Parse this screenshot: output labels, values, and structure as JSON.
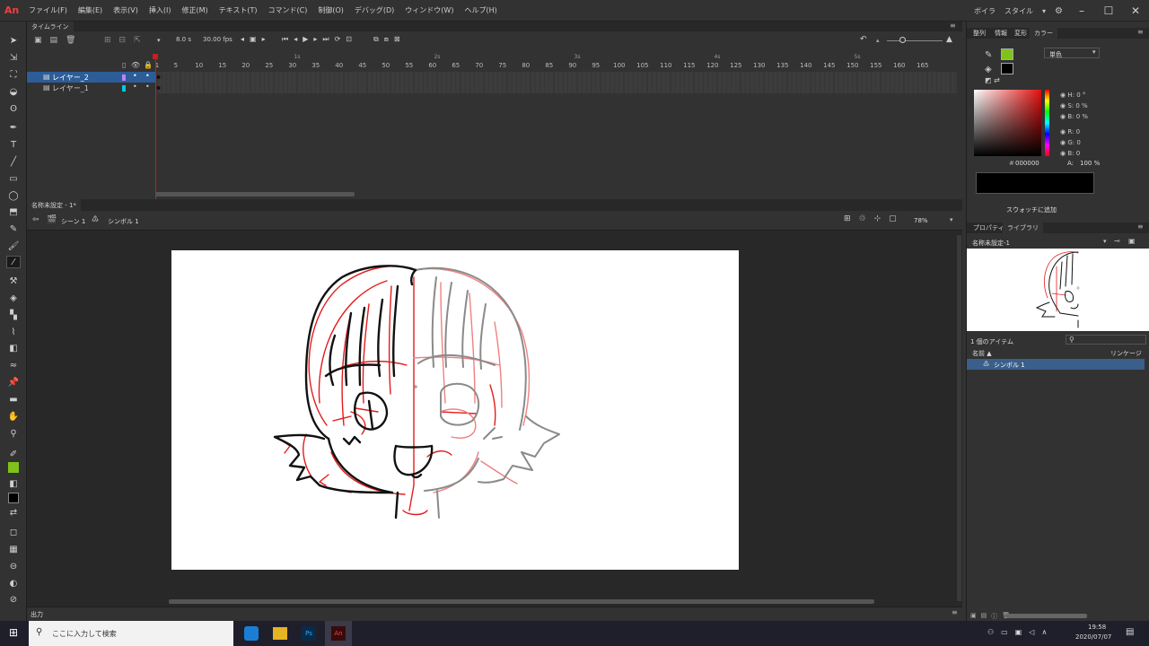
{
  "app": {
    "logo": "An",
    "menus": [
      "ファイル(F)",
      "編集(E)",
      "表示(V)",
      "挿入(I)",
      "修正(M)",
      "テキスト(T)",
      "コマンド(C)",
      "制御(O)",
      "デバッグ(D)",
      "ウィンドウ(W)",
      "ヘルプ(H)"
    ],
    "workspace": "ボイラ",
    "workspace_style": "スタイル"
  },
  "timeline": {
    "tab": "タイムライン",
    "fps": "8.0 s",
    "time": "30.00 fps",
    "ruler": [
      "1",
      "5",
      "10",
      "15",
      "20",
      "25",
      "30",
      "35",
      "40",
      "45",
      "50",
      "55",
      "60",
      "65",
      "70",
      "75",
      "80",
      "85",
      "90",
      "95",
      "100",
      "105",
      "110",
      "115",
      "120",
      "125",
      "130",
      "135",
      "140",
      "145",
      "150",
      "155",
      "160",
      "165"
    ],
    "sec_marks": [
      "1s",
      "2s",
      "3s",
      "4s",
      "5s"
    ],
    "layers": [
      {
        "name": "レイヤー_2",
        "color": "#c080ff",
        "selected": true
      },
      {
        "name": "レイヤー_1",
        "color": "#00c8e0",
        "selected": false
      }
    ]
  },
  "stage": {
    "doc_tab": "名称未設定 - 1*",
    "scene": "シーン 1",
    "symbol": "シンボル 1",
    "zoom": "78%",
    "output_tab": "出力"
  },
  "right": {
    "tabs": [
      "整列",
      "情報",
      "変形",
      "カラー"
    ],
    "color_type": "単色",
    "hsb": [
      {
        "k": "H:",
        "v": "0 °"
      },
      {
        "k": "S:",
        "v": "0 %"
      },
      {
        "k": "B:",
        "v": "0 %"
      }
    ],
    "rgb": [
      {
        "k": "R:",
        "v": "0"
      },
      {
        "k": "G:",
        "v": "0"
      },
      {
        "k": "B:",
        "v": "0"
      }
    ],
    "hex": "000000",
    "alpha_label": "A:",
    "alpha": "100 %",
    "swatch_btn": "スウォッチに追加",
    "lib_tabs": [
      "プロパティ",
      "ライブラリ"
    ],
    "lib_doc": "名称未設定-1",
    "items_count": "1 個のアイテム",
    "col_name": "名前 ▲",
    "col_link": "リンケージ",
    "item": "シンボル 1",
    "stroke_color": "#7ec21b",
    "fill_color": "#000000"
  },
  "taskbar": {
    "search": "ここに入力して検索",
    "time": "19:58",
    "date": "2020/07/07"
  }
}
